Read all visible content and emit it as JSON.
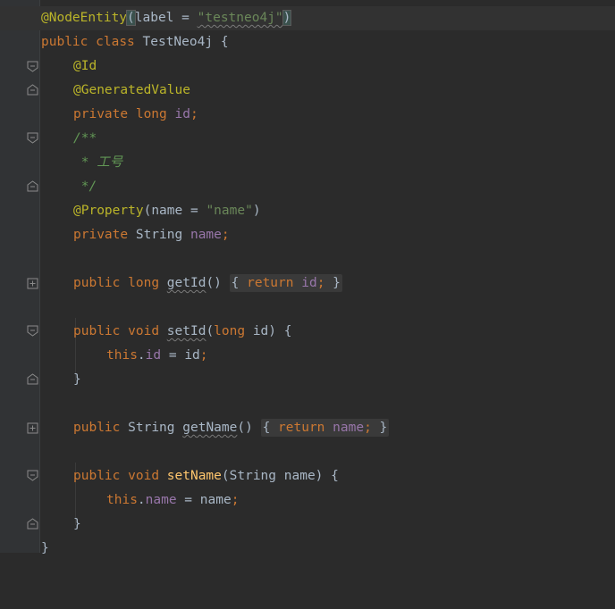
{
  "editor": {
    "lines": [
      {
        "annotation": "@NodeEntity",
        "paren_open": "(",
        "param": "label",
        "eq": " = ",
        "value": "\"testneo4j\"",
        "paren_close": ")"
      },
      {
        "kw1": "public",
        "kw2": "class",
        "name": "TestNeo4j",
        "brace": "{"
      },
      {
        "annotation": "@Id"
      },
      {
        "annotation": "@GeneratedValue"
      },
      {
        "kw1": "private",
        "kw2": "long",
        "field": "id",
        "semi": ";"
      },
      {
        "comment": "/**"
      },
      {
        "comment": " * 工号"
      },
      {
        "comment": " */"
      },
      {
        "annotation": "@Property",
        "paren_open": "(",
        "param": "name",
        "eq": " = ",
        "value": "\"name\"",
        "paren_close": ")"
      },
      {
        "kw1": "private",
        "type": "String",
        "field": "name",
        "semi": ";"
      },
      {
        "kw1": "public",
        "kw2": "long",
        "method": "getId",
        "parens": "()",
        "body_open": "{",
        "ret": "return",
        "field": "id",
        "semi": ";",
        "body_close": "}"
      },
      {
        "kw1": "public",
        "kw2": "void",
        "method": "setId",
        "paren_open": "(",
        "ptype": "long",
        "pname": "id",
        "paren_close": ")",
        "brace": "{"
      },
      {
        "this": "this",
        "dot": ".",
        "field": "id",
        "eq": " = ",
        "rhs": "id",
        "semi": ";"
      },
      {
        "brace": "}"
      },
      {
        "kw1": "public",
        "type": "String",
        "method": "getName",
        "parens": "()",
        "body_open": "{",
        "ret": "return",
        "field": "name",
        "semi": ";",
        "body_close": "}"
      },
      {
        "kw1": "public",
        "kw2": "void",
        "method": "setName",
        "paren_open": "(",
        "ptype": "String",
        "pname": "name",
        "paren_close": ")",
        "brace": "{"
      },
      {
        "this": "this",
        "dot": ".",
        "field": "name",
        "eq": " = ",
        "rhs": "name",
        "semi": ";"
      },
      {
        "brace": "}"
      },
      {
        "brace": "}"
      }
    ]
  },
  "colors": {
    "background": "#2b2b2b",
    "gutter": "#313335",
    "keyword": "#cc7832",
    "annotation": "#bbb529",
    "string": "#6a8759",
    "field": "#9876aa",
    "method": "#ffc66d",
    "comment": "#629755",
    "text": "#a9b7c6"
  },
  "icons": {
    "fold_start": "fold-open-icon",
    "fold_end": "fold-end-icon",
    "fold_collapsed": "fold-plus-icon"
  }
}
